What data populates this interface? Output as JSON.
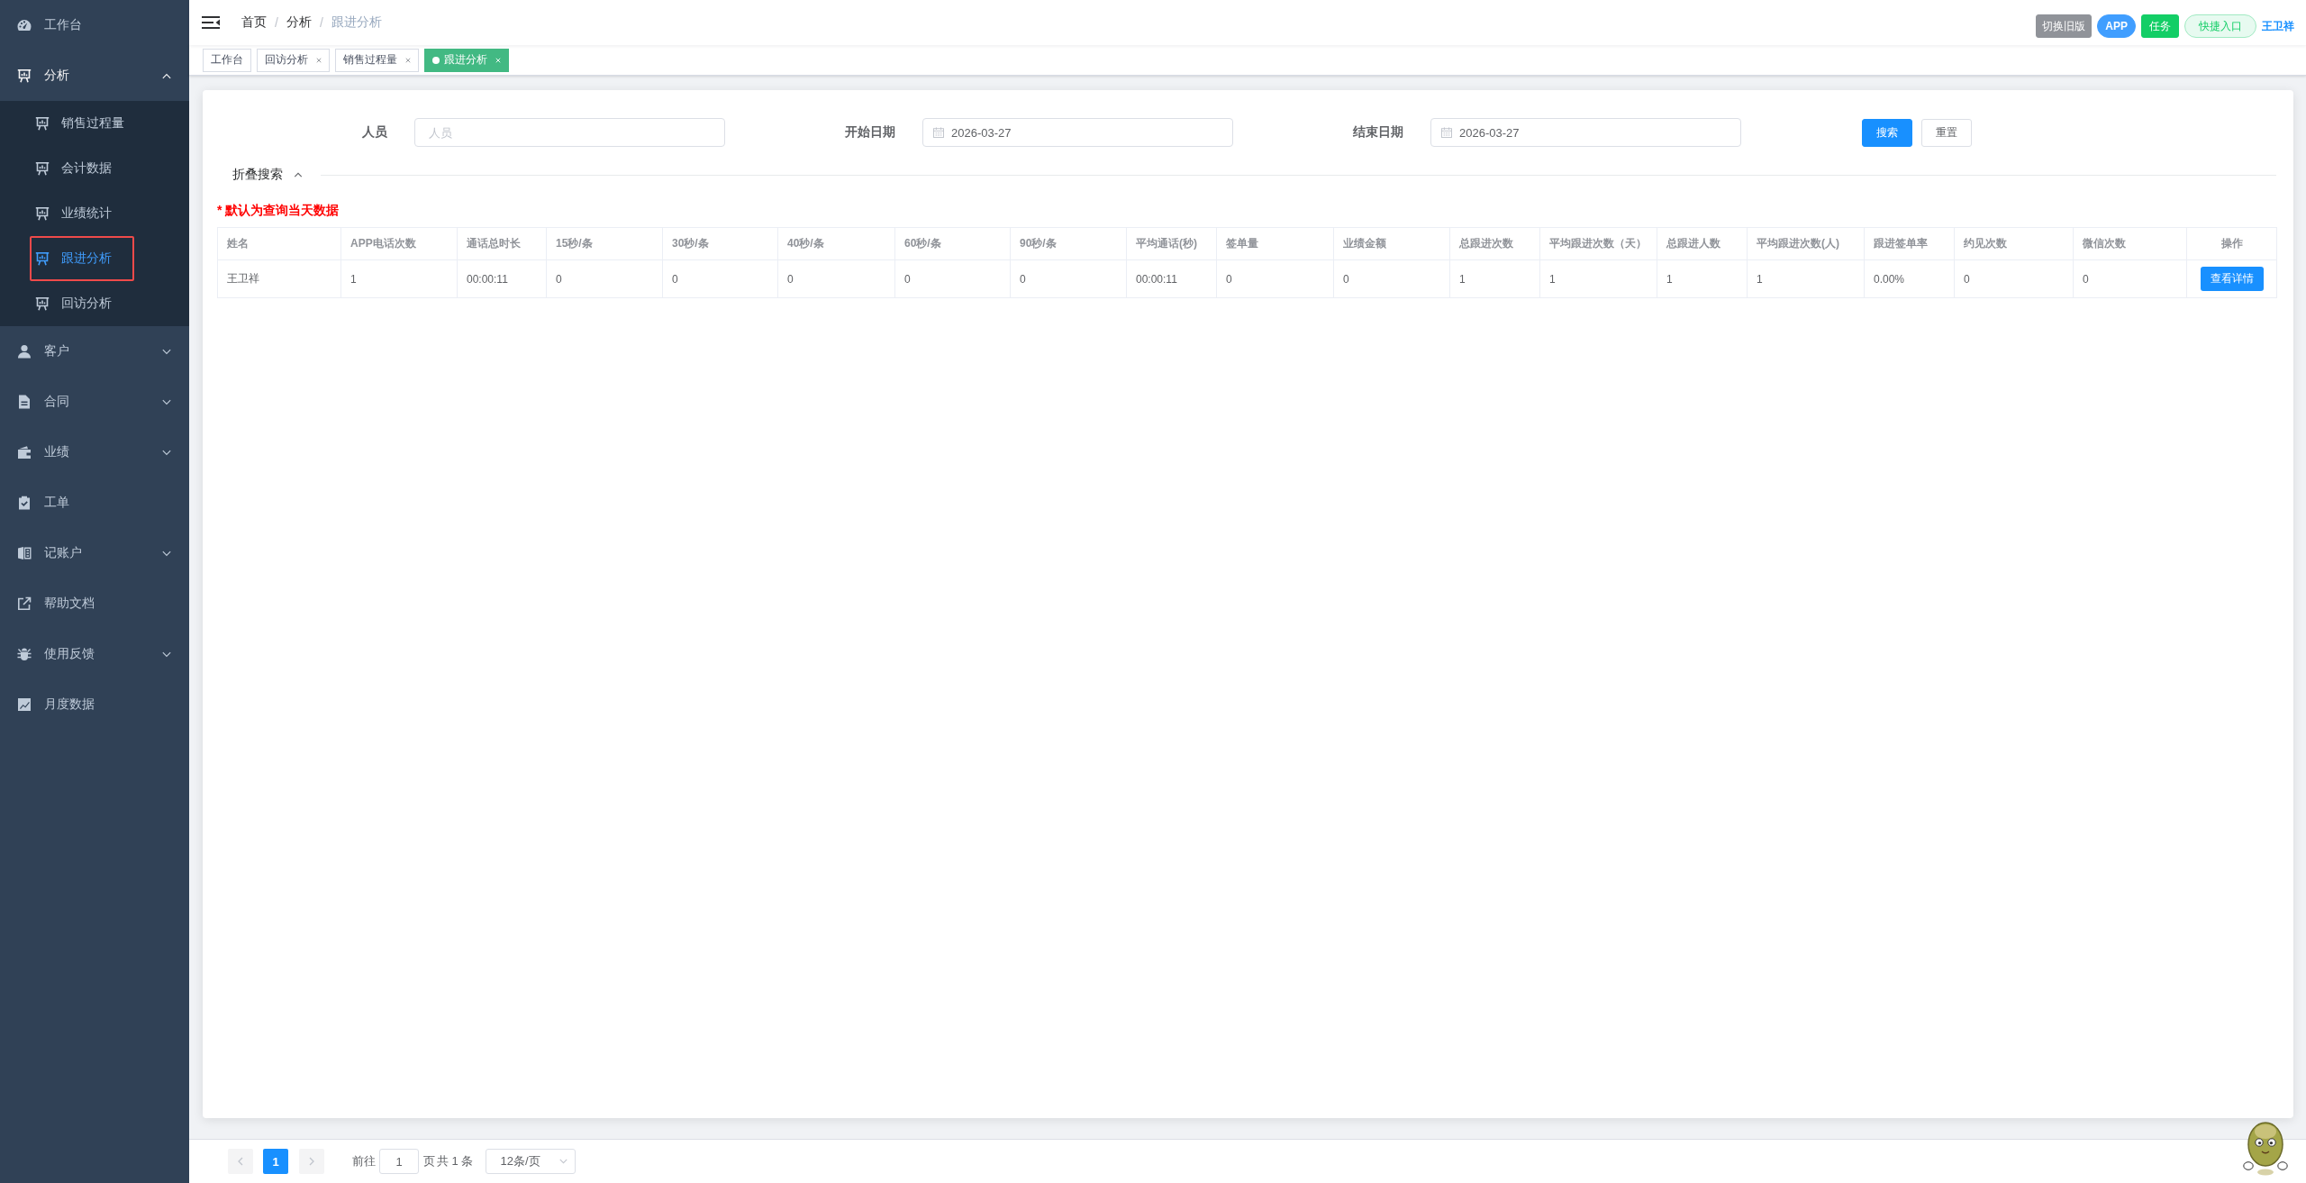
{
  "sidebar": {
    "items": [
      {
        "label": "工作台",
        "kind": "link"
      },
      {
        "label": "分析",
        "kind": "group",
        "expanded": true,
        "children": [
          {
            "label": "销售过程量",
            "selected": false,
            "highlighted": false
          },
          {
            "label": "会计数据",
            "selected": false,
            "highlighted": false
          },
          {
            "label": "业绩统计",
            "selected": false,
            "highlighted": false
          },
          {
            "label": "跟进分析",
            "selected": true,
            "highlighted": true
          },
          {
            "label": "回访分析",
            "selected": false,
            "highlighted": false
          }
        ]
      },
      {
        "label": "客户",
        "kind": "group",
        "expanded": false
      },
      {
        "label": "合同",
        "kind": "group",
        "expanded": false
      },
      {
        "label": "业绩",
        "kind": "group",
        "expanded": false
      },
      {
        "label": "工单",
        "kind": "link"
      },
      {
        "label": "记账户",
        "kind": "group",
        "expanded": false
      },
      {
        "label": "帮助文档",
        "kind": "link"
      },
      {
        "label": "使用反馈",
        "kind": "group",
        "expanded": false
      },
      {
        "label": "月度数据",
        "kind": "link"
      }
    ]
  },
  "header": {
    "breadcrumb": [
      {
        "label": "首页",
        "separator": "/",
        "current": false
      },
      {
        "label": "分析",
        "separator": "/",
        "current": false
      },
      {
        "label": "跟进分析",
        "current": true
      }
    ],
    "actions": [
      {
        "label": "切换旧版",
        "kind": "info"
      },
      {
        "label": "APP",
        "kind": "round"
      },
      {
        "label": "任务",
        "kind": "success"
      },
      {
        "label": "快捷入口",
        "kind": "plain"
      }
    ],
    "user": "王卫祥"
  },
  "tabs": [
    {
      "label": "工作台",
      "selected": false,
      "closable": false
    },
    {
      "label": "回访分析",
      "selected": false,
      "closable": true
    },
    {
      "label": "销售过程量",
      "selected": false,
      "closable": true
    },
    {
      "label": "跟进分析",
      "selected": true,
      "closable": true
    }
  ],
  "search": {
    "filters": [
      {
        "label": "人员",
        "kind": "text",
        "placeholder": "人员"
      },
      {
        "label": "开始日期",
        "kind": "date",
        "value": "2026-03-27"
      },
      {
        "label": "结束日期",
        "kind": "date",
        "value": "2026-03-27"
      }
    ],
    "buttons": [
      {
        "label": "搜索",
        "kind": "primary"
      },
      {
        "label": "重置",
        "kind": "default"
      }
    ],
    "collapse": {
      "label": "折叠搜索",
      "expanded": true
    }
  },
  "notice": "* 默认为查询当天数据",
  "table": {
    "columns": [
      "姓名",
      "APP电话次数",
      "通话总时长",
      "15秒/条",
      "30秒/条",
      "40秒/条",
      "60秒/条",
      "90秒/条",
      "平均通话(秒)",
      "签单量",
      "业绩金额",
      "总跟进次数",
      "平均跟进次数（天）",
      "总跟进人数",
      "平均跟进次数(人)",
      "跟进签单率",
      "约见次数",
      "微信次数",
      "操作"
    ],
    "rows": [
      {
        "cells": [
          "王卫祥",
          "1",
          "00:00:11",
          "0",
          "0",
          "0",
          "0",
          "0",
          "00:00:11",
          "0",
          "0",
          "1",
          "1",
          "1",
          "1",
          "0.00%",
          "0",
          "0"
        ],
        "action": "查看详情"
      }
    ]
  },
  "pagination": {
    "prev_disabled": true,
    "pages": [
      {
        "label": "1",
        "selected": true
      }
    ],
    "next_disabled": true,
    "goto_label": "前往",
    "goto_value": "1",
    "goto_suffix": "页",
    "total": "共 1 条",
    "page_size": "12条/页"
  }
}
